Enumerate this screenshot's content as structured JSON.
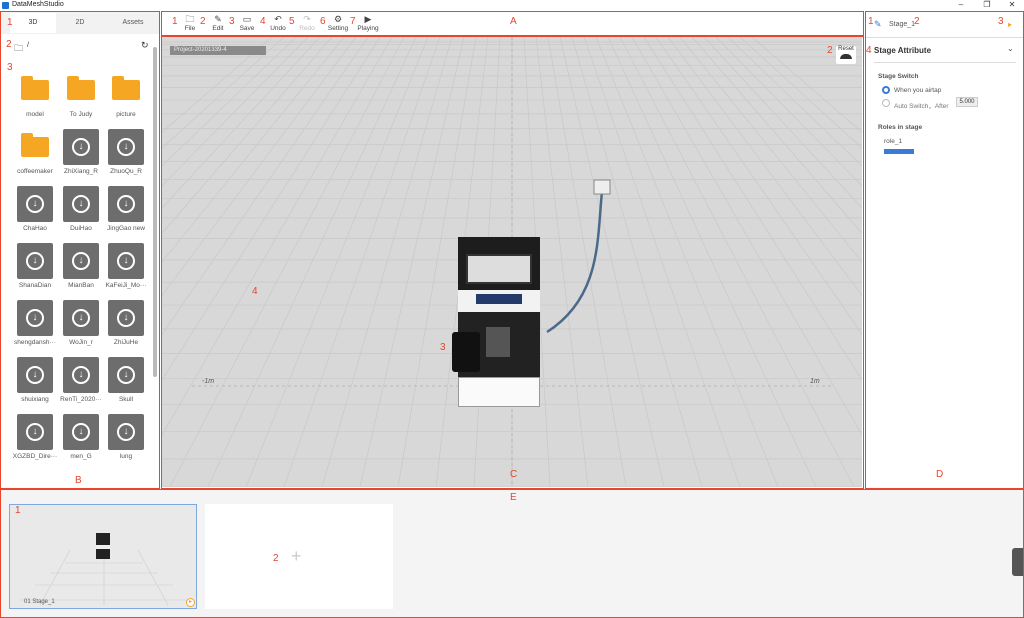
{
  "app": {
    "title": "DataMeshStudio"
  },
  "left_panel": {
    "tabs": [
      "3D",
      "2D",
      "Assets"
    ],
    "path": "/",
    "items": [
      {
        "label": "model",
        "kind": "folder"
      },
      {
        "label": "To Judy",
        "kind": "folder"
      },
      {
        "label": "picture",
        "kind": "folder"
      },
      {
        "label": "coffeemaker",
        "kind": "folder"
      },
      {
        "label": "ZhiXiang_R",
        "kind": "model"
      },
      {
        "label": "ZhuoQu_R",
        "kind": "model"
      },
      {
        "label": "ChaHao",
        "kind": "model"
      },
      {
        "label": "DuiHao",
        "kind": "model"
      },
      {
        "label": "JingGao new",
        "kind": "model"
      },
      {
        "label": "ShanaDian",
        "kind": "model"
      },
      {
        "label": "MianBan",
        "kind": "model"
      },
      {
        "label": "KaFeiJi_Mo···",
        "kind": "model"
      },
      {
        "label": "shengdansh···",
        "kind": "model"
      },
      {
        "label": "WoJin_r",
        "kind": "model"
      },
      {
        "label": "ZhiJuHe",
        "kind": "model"
      },
      {
        "label": "shuixiang",
        "kind": "model"
      },
      {
        "label": "RenTi_2020···",
        "kind": "model"
      },
      {
        "label": "Skull",
        "kind": "model"
      },
      {
        "label": "XGZBD_Dire···",
        "kind": "model"
      },
      {
        "label": "men_G",
        "kind": "model"
      },
      {
        "label": "lung",
        "kind": "model"
      },
      {
        "label": "",
        "kind": "model"
      },
      {
        "label": "",
        "kind": "model"
      },
      {
        "label": "",
        "kind": "model"
      }
    ]
  },
  "toolbar": {
    "items": [
      {
        "label": "File",
        "icon": "folder-icon",
        "glyph": "🗀"
      },
      {
        "label": "Edit",
        "icon": "edit-icon",
        "glyph": "✎"
      },
      {
        "label": "Save",
        "icon": "save-icon",
        "glyph": "▭"
      },
      {
        "label": "Undo",
        "icon": "undo-icon",
        "glyph": "↶"
      },
      {
        "label": "Redo",
        "icon": "redo-icon",
        "glyph": "↷"
      },
      {
        "label": "Setting",
        "icon": "gear-icon",
        "glyph": "⚙"
      },
      {
        "label": "Playing",
        "icon": "play-icon",
        "glyph": "▶"
      }
    ]
  },
  "viewport": {
    "project_name": "Project-20201339-4",
    "reset_label": "Reset",
    "axis_neg": "-1m",
    "axis_pos": "1m"
  },
  "right_panel": {
    "stage_name": "Stage_1",
    "section_title": "Stage Attribute",
    "stage_switch_label": "Stage Switch",
    "option_airtap": "When you airtap",
    "option_auto": "Auto Switch，After",
    "auto_value": "5.000",
    "roles_label": "Roles in stage",
    "role_name": "role_1"
  },
  "bottom": {
    "stage_card_label": "01  Stage_1"
  },
  "annotations": {
    "areas": [
      "A",
      "B",
      "C",
      "D",
      "E"
    ],
    "numbers": [
      "1",
      "2",
      "3",
      "4",
      "5",
      "6",
      "7"
    ]
  },
  "colors": {
    "accent": "#e8452c",
    "selection": "#3a7bd5",
    "folder": "#f5a623",
    "viewport_bg": "#d8d8d8"
  }
}
